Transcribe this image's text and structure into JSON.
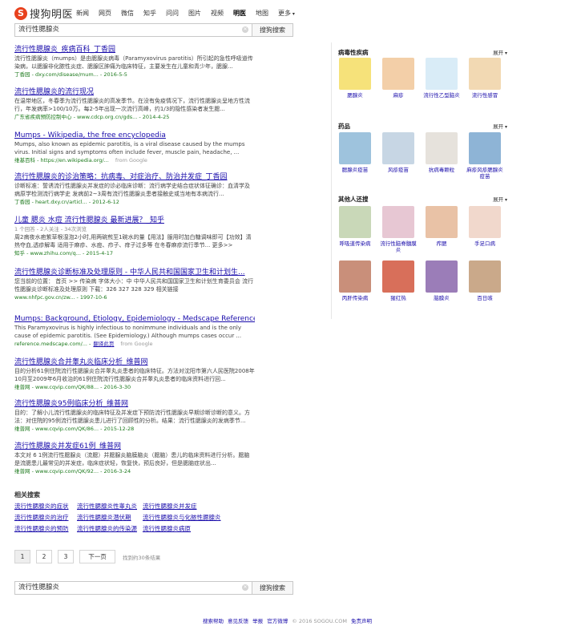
{
  "header": {
    "logo_badge": "S",
    "logo_text": "搜狗明医",
    "nav": [
      "新闻",
      "网页",
      "微信",
      "知乎",
      "问问",
      "图片",
      "视频",
      "明医",
      "地图",
      "更多"
    ],
    "active_nav_index": 7
  },
  "search": {
    "query": "流行性腮腺炎",
    "button": "搜狗搜索",
    "clear_icon": "close-icon"
  },
  "results": [
    {
      "title": "流行性腮腺炎_疾病百科_丁香园",
      "snippet": "流行性腮腺炎（mumps）是由腮腺炎病毒（Paramyxovirus parotitis）所引起的急性呼吸道传染病，以腮腺非化脓性炎症、腮腺区肿痛为临床特征，主要发生在儿童和青少年，腮腺...",
      "url": "丁香园 - dxy.com/disease/mum... - 2016-5-5"
    },
    {
      "title": "流行性腮腺炎的流行现况",
      "snippet": "在温带地区，冬春季为流行性腮腺炎的高发季节。在没有免疫情况下，流行性腮腺炎呈地方性流行，年发病率>100/10万。每2-5年出现一次流行高峰，约1/3的隐性感染者发生腮...",
      "url": "广东省疾病预防控制中心 - www.cdcp.org.cn/gds... - 2014-4-25"
    },
    {
      "title": "Mumps - Wikipedia, the free encyclopedia",
      "snippet": "Mumps, also known as epidemic parotitis, is a viral disease caused by the mumps virus. Initial signs and symptoms often include fever, muscle pain, headache, ...",
      "url": "维基百科 - https://en.wikipedia.org/...",
      "source": "from Google"
    },
    {
      "title": "流行性腮腺炎的诊治策略：抗病毒、对症治疗、防治并发症_丁香园",
      "snippet": "诊断标准：誓诱流行性腮腺炎并发症的诊必临床诊断：流行病学史结合症状体征确诊：血清学及病原学检测流行病学史 发病前2~3周有流行性腮腺炎患者接触史或当地有本病流行...",
      "url": "丁香园 - heart.dxy.cn/articl... - 2012-6-12"
    },
    {
      "title": "儿童 腮炎 水痘 流行性腮腺炎 最新进展？_知乎",
      "meta": "1 个回答 - 2人关注 - 34次浏览",
      "snippet": "周2病夜水疤紫草根湿泡2小时,用两碗煎至1碗水的量【用法】服用时加白糖调味即可【功效】清热夺血,透疹解毒 适用于麻疹、水痘、疖子、痱子过多等 在冬春麻疹流行季节... 更多>>",
      "url": "知乎 - www.zhihu.com/q... - 2015-4-17"
    },
    {
      "title": "流行性腮腺炎诊断标准及处理原则 - 中华人民共和国国家卫生和计划生...",
      "snippet": "您当前的位置： 首页 >> 传染病 字体大小：中 中华人民共和国国家卫生和计划生育委员会 流行性腮腺炎诊断标准及处理原则 下载：326 327 328 329 相关链接",
      "url": "www.nhfpc.gov.cn/zw... - 1997-10-6"
    },
    {
      "title": "Mumps: Background, Etiology, Epidemiology - Medscape Reference",
      "snippet": "This Paramyxovirus is highly infectious to nonimmune individuals and is the only cause of epidemic parotitis. (See Epidemiology.) Although mumps cases occur ...",
      "url": "reference.medscape.com/... -",
      "translate": "翻译此页",
      "source": "from Google"
    },
    {
      "title": "流行性腮腺炎合并睾丸炎临床分析_维普网",
      "snippet": "目的分析61例住院流行性腮腺炎合并睾丸炎患者的临床特征。方法对沈阳市第六人民医院2008年10月至2009年6月收治的61例住院流行性腮腺炎合并睾丸炎患者的临床资料进行回...",
      "url": "维普网 - www.cqvip.com/QK/88... - 2016-3-30"
    },
    {
      "title": "流行性腮腺炎95例临床分析_维普网",
      "snippet": "目的：了解小儿流行性腮腺炎的临床特征及并发症下预防流行性腮腺炎早期诊断诊断的意义。方法：对住院的95例流行性腮腺炎患儿进行了回顾性的分析。结果：流行性腮腺炎的发病季节...",
      "url": "维普网 - www.cqvip.com/QK/86... - 2015-12-28"
    },
    {
      "title": "流行性腮腺炎并发症61例_维普网",
      "snippet": "本文对 6 1例流行性腮腺炎（流腮）并腮腺炎脑膜脑炎（腮脑）患儿的临床资料进行分析。腮脑是流腮患儿最常见的并发症，临床症状轻，恢复快，预后良好，但是腮脑症状出...",
      "url": "维普网 - www.cqvip.com/QK/92... - 2016-3-24"
    }
  ],
  "related": {
    "heading": "相关搜索",
    "items": [
      "流行性腮腺炎的症状",
      "流行性腮腺炎性睾丸炎",
      "流行性腮腺炎并发症",
      "流行性腮腺炎的治疗",
      "流行性腮腺炎潜伏期",
      "流行性腮腺炎与化脓性腮腺炎",
      "流行性腮腺炎的预防",
      "流行性腮腺炎的传染源",
      "流行性腮腺炎病原"
    ]
  },
  "pager": {
    "pages": [
      "1",
      "2",
      "3"
    ],
    "current": "1",
    "next": "下一页",
    "info": "找到约30条结果"
  },
  "panel": {
    "sections": [
      {
        "title": "病毒性疾病",
        "expand": "展开",
        "items": [
          {
            "label": "腮腺炎",
            "color": "#f6e27a"
          },
          {
            "label": "麻疹",
            "color": "#f3cfa8"
          },
          {
            "label": "流行性乙型脑炎",
            "color": "#d9ecf7"
          },
          {
            "label": "流行性感冒",
            "color": "#f2d9b3"
          }
        ]
      },
      {
        "title": "药品",
        "expand": "展开",
        "items": [
          {
            "label": "腮腺炎疫苗",
            "color": "#9ec3dd"
          },
          {
            "label": "风疹疫苗",
            "color": "#c7d6e4"
          },
          {
            "label": "抗病毒颗粒",
            "color": "#e6e2dc"
          },
          {
            "label": "麻疹风疹腮腺炎疫苗",
            "color": "#8eb4d6"
          }
        ]
      },
      {
        "title": "其他人还搜",
        "expand": "展开",
        "items": [
          {
            "label": "呼吸道传染病",
            "color": "#c9d8b8"
          },
          {
            "label": "流行性脑脊髓膜炎",
            "color": "#e7c7d3"
          },
          {
            "label": "痄腮",
            "color": "#e9c2a6"
          },
          {
            "label": "手足口病",
            "color": "#f1d8cc"
          },
          {
            "label": "丙肝传染病",
            "color": "#c98f7a"
          },
          {
            "label": "猩红热",
            "color": "#d86f5a"
          },
          {
            "label": "脑膜炎",
            "color": "#9b7db8"
          },
          {
            "label": "百日咳",
            "color": "#caa98a"
          }
        ]
      }
    ]
  },
  "footer": {
    "links": [
      "搜索帮助",
      "意见反馈",
      "举报",
      "官方微博"
    ],
    "copyright": "© 2016 SOGOU.COM",
    "disclaimer": "免责声明"
  },
  "colors": {
    "link": "#1a0dab",
    "highlight": "#d8000c",
    "url": "#1d7a1d",
    "logo": "#e8411d"
  }
}
